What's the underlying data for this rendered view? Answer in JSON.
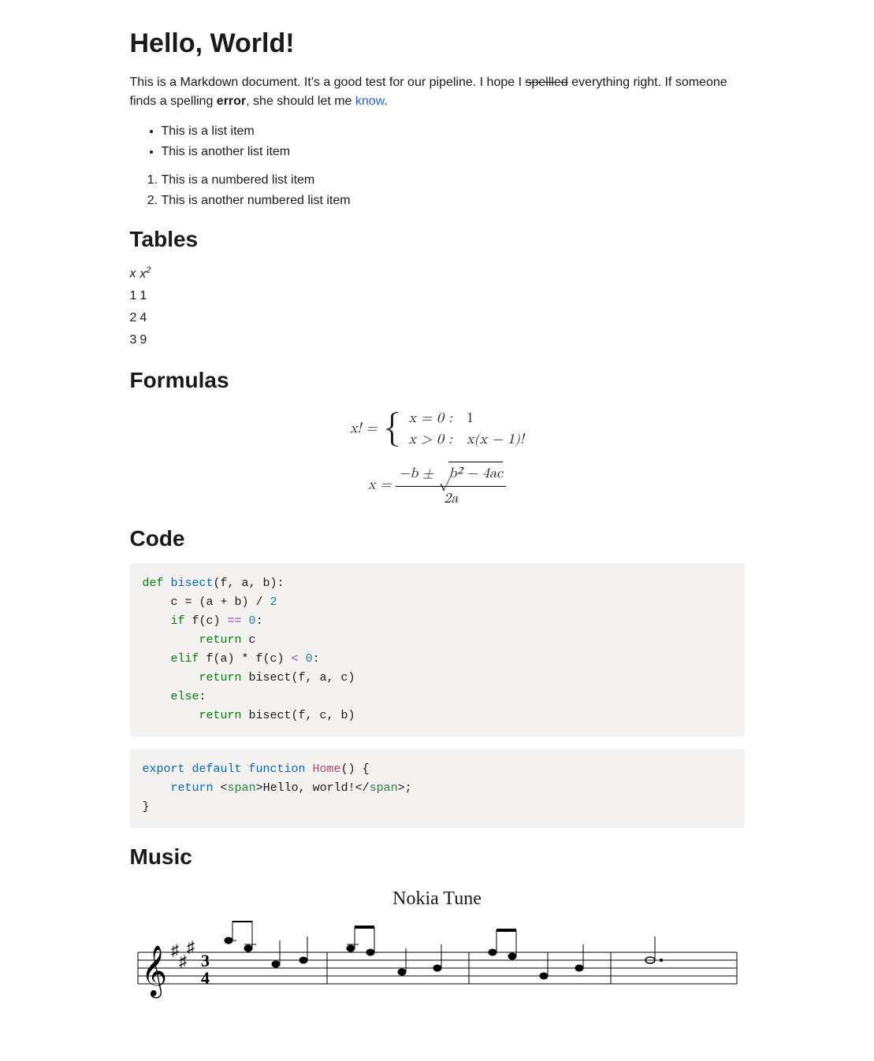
{
  "title": "Hello, World!",
  "intro": {
    "part1": "This is a Markdown document. It's a good test for our pipeline. I hope I ",
    "strike": "spellled",
    "part2": " everything right. If someone finds a spelling ",
    "bold": "error",
    "part3": ", she should let me ",
    "link": "know",
    "part4": "."
  },
  "ul_items": [
    "This is a list item",
    "This is another list item"
  ],
  "ol_items": [
    "This is a numbered list item",
    "This is another numbered list item"
  ],
  "sections": {
    "tables": "Tables",
    "formulas": "Formulas",
    "code": "Code",
    "music": "Music"
  },
  "table": {
    "header_x": "x",
    "header_x2_base": "x",
    "header_x2_exp": "2",
    "rows": [
      {
        "x": "1",
        "x2": "1"
      },
      {
        "x": "2",
        "x2": "4"
      },
      {
        "x": "3",
        "x2": "9"
      }
    ]
  },
  "formulas": {
    "factorial_lhs": "x! =",
    "case1_cond": "x = 0 :",
    "case1_val": "1",
    "case2_cond": "x > 0 :",
    "case2_val": "x(x − 1)!",
    "quad_lhs": "x =",
    "quad_num_pre": "−b ± ",
    "quad_rad_inner": "b² − 4ac",
    "quad_den": "2a"
  },
  "code1": {
    "t_def": "def ",
    "t_bisect": "bisect",
    "t_sig": "(f, a, b):",
    "t_line2a": "    c = (a + b) / ",
    "t_line2b": "2",
    "t_if": "    if ",
    "t_fc": "f(c) ",
    "t_eq": "== ",
    "t_zero": "0",
    "t_colon": ":",
    "t_return": "        return ",
    "t_c": "c",
    "t_elif": "    elif ",
    "t_fa": "f(a) * f(c) ",
    "t_lt": "< ",
    "t_zero2": "0",
    "t_colon2": ":",
    "t_return2": "        return ",
    "t_call2": "bisect(f, a, c)",
    "t_else": "    else",
    "t_colon3": ":",
    "t_return3": "        return ",
    "t_call3": "bisect(f, c, b)"
  },
  "code2": {
    "t_export": "export default function ",
    "t_home": "Home",
    "t_paren": "() {",
    "t_return": "    return ",
    "t_open1": "<",
    "t_span": "span",
    "t_open2": ">",
    "t_text": "Hello, world!",
    "t_close1": "</",
    "t_close2": ">",
    "t_semi": ";",
    "t_end": "}"
  },
  "music": {
    "title": "Nokia Tune",
    "key": "A major",
    "time_signature": "3/4"
  }
}
